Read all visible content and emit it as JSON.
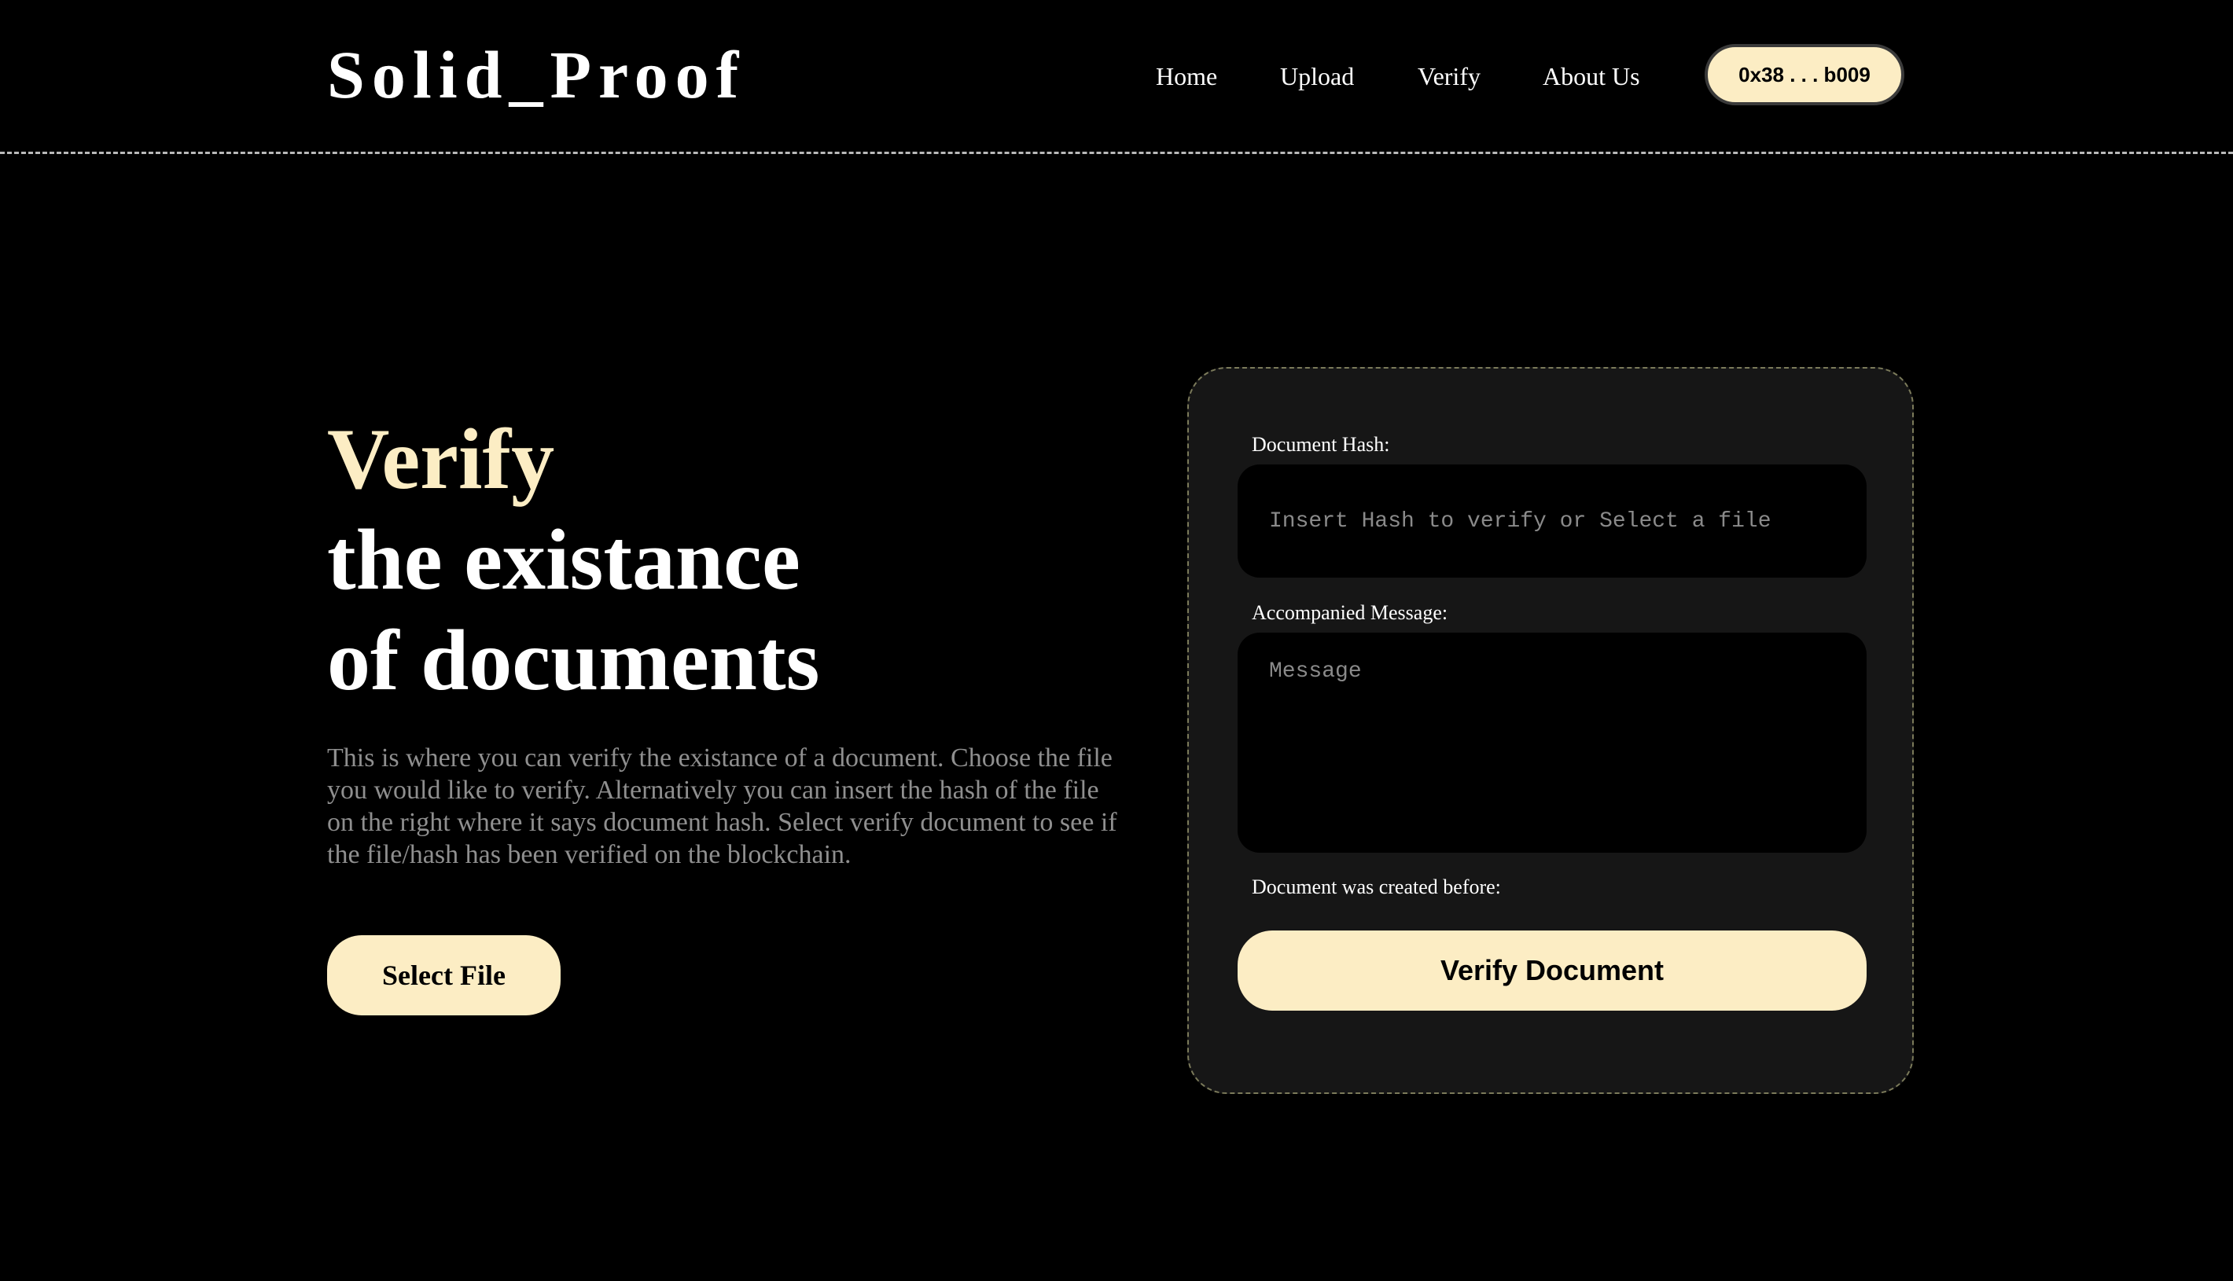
{
  "brand": {
    "logo": "Solid_Proof"
  },
  "nav": {
    "home": "Home",
    "upload": "Upload",
    "verify": "Verify",
    "about": "About Us",
    "wallet": "0x38 . . . b009"
  },
  "hero": {
    "accent": "Verify",
    "line2": "the existance",
    "line3": "of documents",
    "description": "This is where you can verify the existance of a document. Choose the file you would like to verify. Alternatively you can insert the hash of the file on the right where it says document hash. Select verify document to see if the file/hash has been verified on the blockchain.",
    "select_file": "Select File"
  },
  "form": {
    "hash_label": "Document Hash:",
    "hash_value": "",
    "hash_placeholder": "Insert Hash to verify or Select a file",
    "message_label": "Accompanied Message:",
    "message_value": "",
    "message_placeholder": "Message",
    "created_label": "Document was created before:",
    "verify_button": "Verify Document"
  },
  "colors": {
    "accent": "#fcedc4",
    "background": "#000000",
    "panel": "#161616",
    "muted_text": "#8f8f8f"
  }
}
